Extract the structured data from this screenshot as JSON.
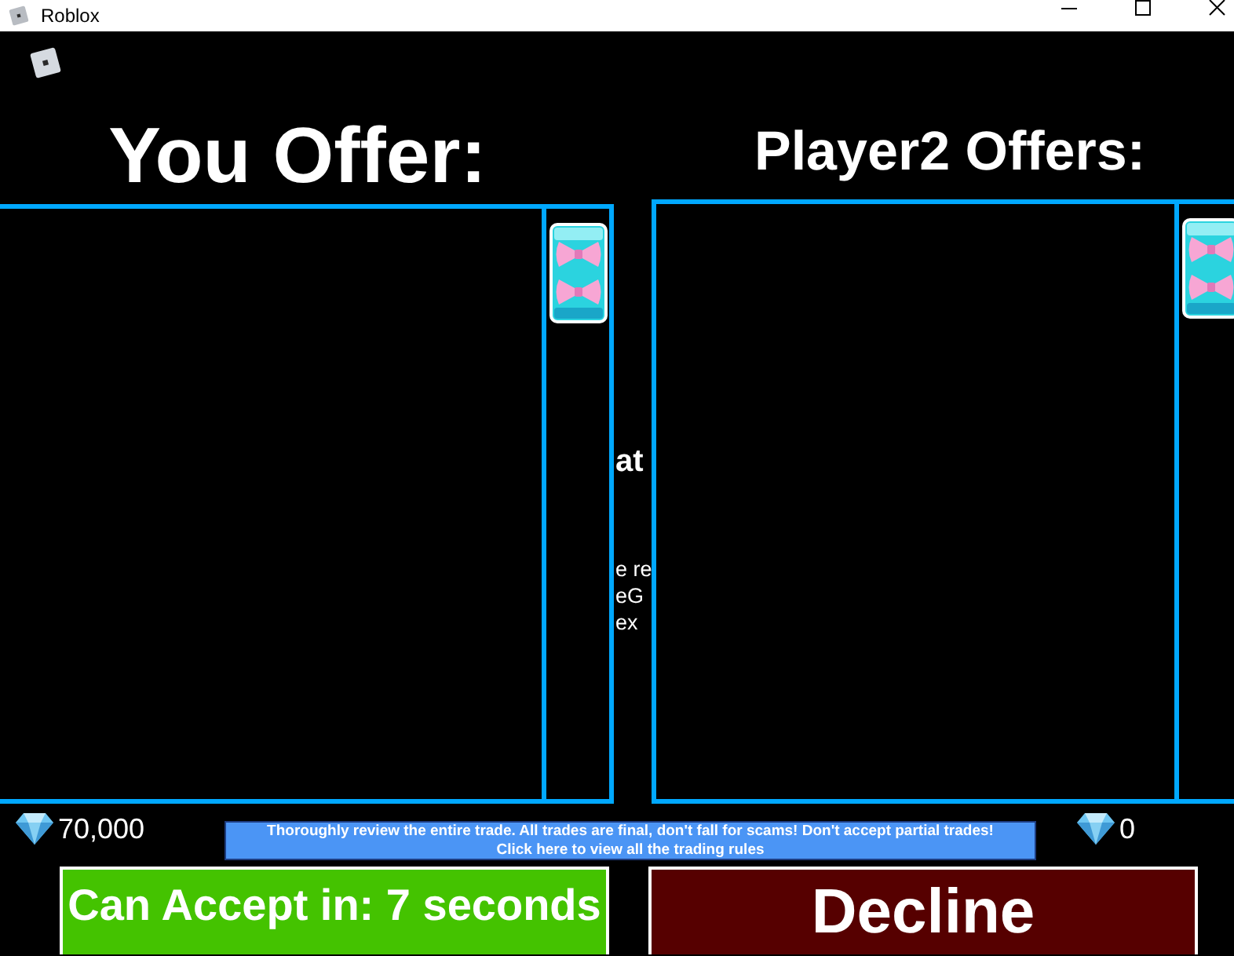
{
  "window": {
    "title": "Roblox"
  },
  "offers": [
    {
      "kind": "own",
      "heading": "You Offer:",
      "gems": "70,000"
    },
    {
      "kind": "partner",
      "heading": "Player2 Offers:",
      "gems": "0"
    }
  ],
  "background_text": {
    "heading": "at",
    "lines": [
      "e re",
      "eG",
      "ex"
    ]
  },
  "notice": {
    "lines": [
      "Thoroughly review the entire trade. All trades are final, don't fall for scams! Don't accept partial trades!",
      "Click here to view all the trading rules"
    ]
  },
  "buttons": [
    {
      "kind": "accept",
      "label": "Can Accept in: 7 seconds"
    },
    {
      "kind": "decline",
      "label": "Decline"
    }
  ]
}
